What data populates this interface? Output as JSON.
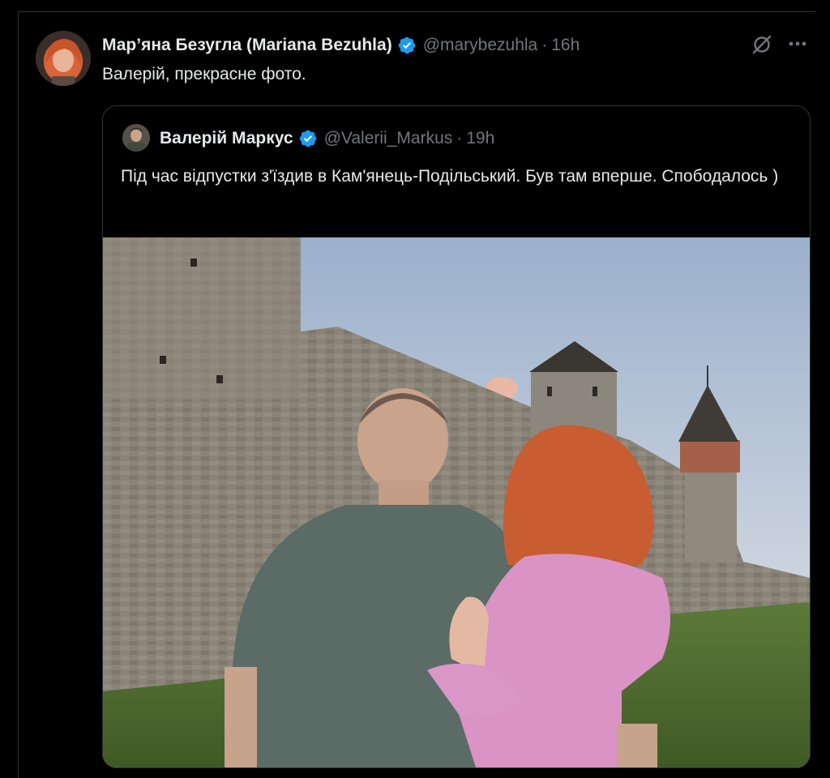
{
  "tweet": {
    "author_name": "Мар’яна Безугла (Mariana Bezuhla)",
    "handle": "@marybezuhla",
    "separator": "·",
    "time": "16h",
    "text": "Валерій, прекрасне фото."
  },
  "quoted_tweet": {
    "author_name": "Валерій Маркус",
    "handle": "@Valerii_Markus",
    "separator": "·",
    "time": "19h",
    "text": "Під час відпустки з'їздив в Кам'янець-Подільський. Був там вперше. Спободалось )"
  },
  "icons": {
    "verified": "verified-badge-icon",
    "grok": "grok-icon",
    "more": "more-options-icon"
  },
  "colors": {
    "background": "#000000",
    "text_primary": "#e7e9ea",
    "text_secondary": "#71767b",
    "verified_blue": "#1d9bf0",
    "border": "#2f3336"
  }
}
